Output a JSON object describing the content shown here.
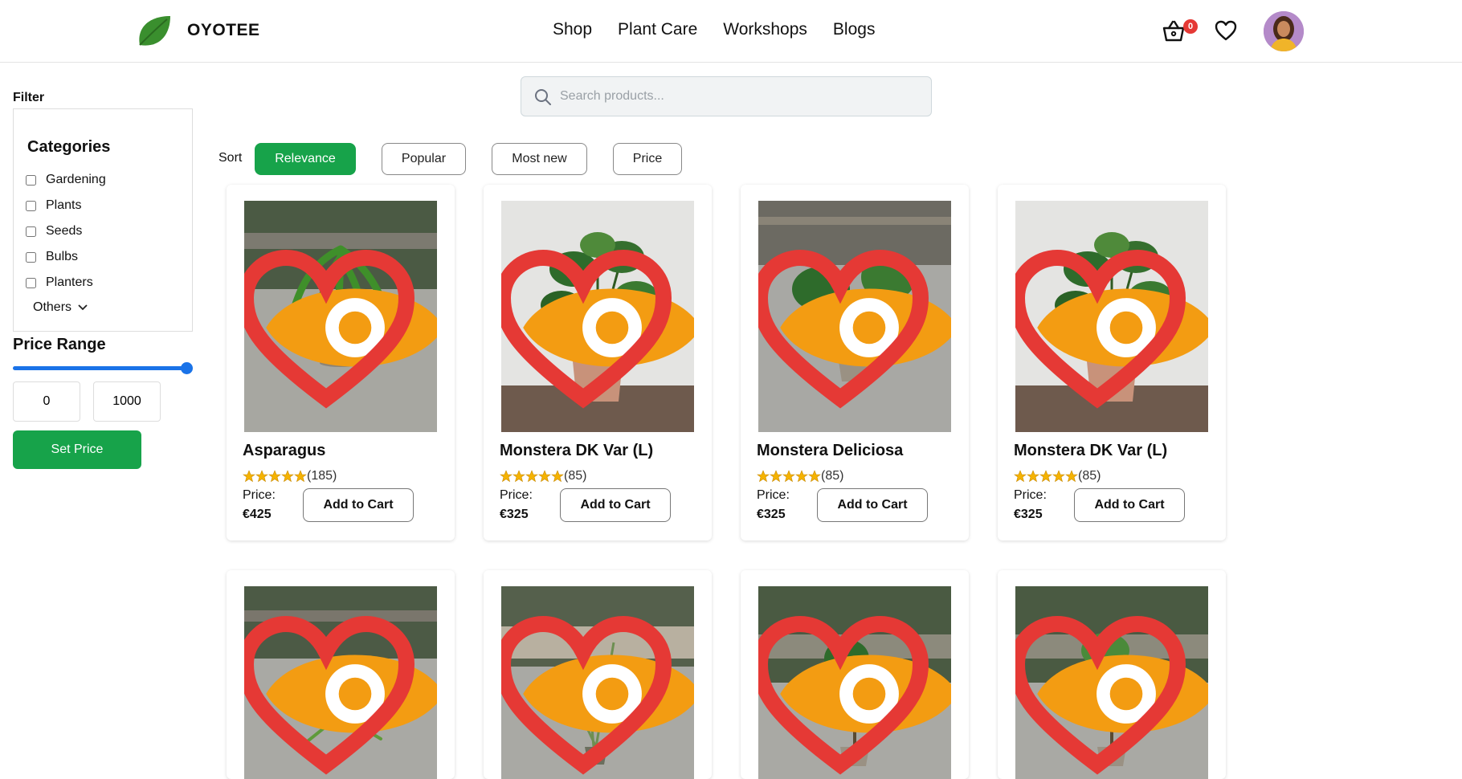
{
  "header": {
    "brand": "OYOTEE",
    "nav": [
      "Shop",
      "Plant Care",
      "Workshops",
      "Blogs"
    ],
    "cart_count": "0",
    "icons": [
      "leaf-logo-icon",
      "basket-icon",
      "heart-icon",
      "avatar"
    ]
  },
  "sidebar": {
    "filter_title": "Filter",
    "categories_title": "Categories",
    "categories": [
      "Gardening",
      "Plants",
      "Seeds",
      "Bulbs",
      "Planters"
    ],
    "others_label": "Others",
    "price_range_title": "Price Range",
    "price_min": "0",
    "price_max": "1000",
    "set_price_label": "Set Price"
  },
  "search": {
    "placeholder": "Search products..."
  },
  "sort": {
    "label": "Sort",
    "options": [
      "Relevance",
      "Popular",
      "Most new",
      "Price"
    ],
    "active": "Relevance"
  },
  "products": [
    {
      "name": "Asparagus",
      "reviews": "(185)",
      "price_label": "Price:",
      "price": "€425",
      "rating": 5,
      "add_label": "Add to Cart"
    },
    {
      "name": "Monstera DK Var (L)",
      "reviews": "(85)",
      "price_label": "Price:",
      "price": "€325",
      "rating": 5,
      "add_label": "Add to Cart"
    },
    {
      "name": "Monstera Deliciosa",
      "reviews": "(85)",
      "price_label": "Price:",
      "price": "€325",
      "rating": 5,
      "add_label": "Add to Cart"
    },
    {
      "name": "Monstera DK Var (L)",
      "reviews": "(85)",
      "price_label": "Price:",
      "price": "€325",
      "rating": 5,
      "add_label": "Add to Cart"
    }
  ],
  "colors": {
    "accent_green": "#17a34a",
    "slider_blue": "#1a73e8",
    "badge_red": "#e53935",
    "star_gold": "#f5b301",
    "eye_orange": "#f39c12",
    "heart_red": "#e53935"
  }
}
